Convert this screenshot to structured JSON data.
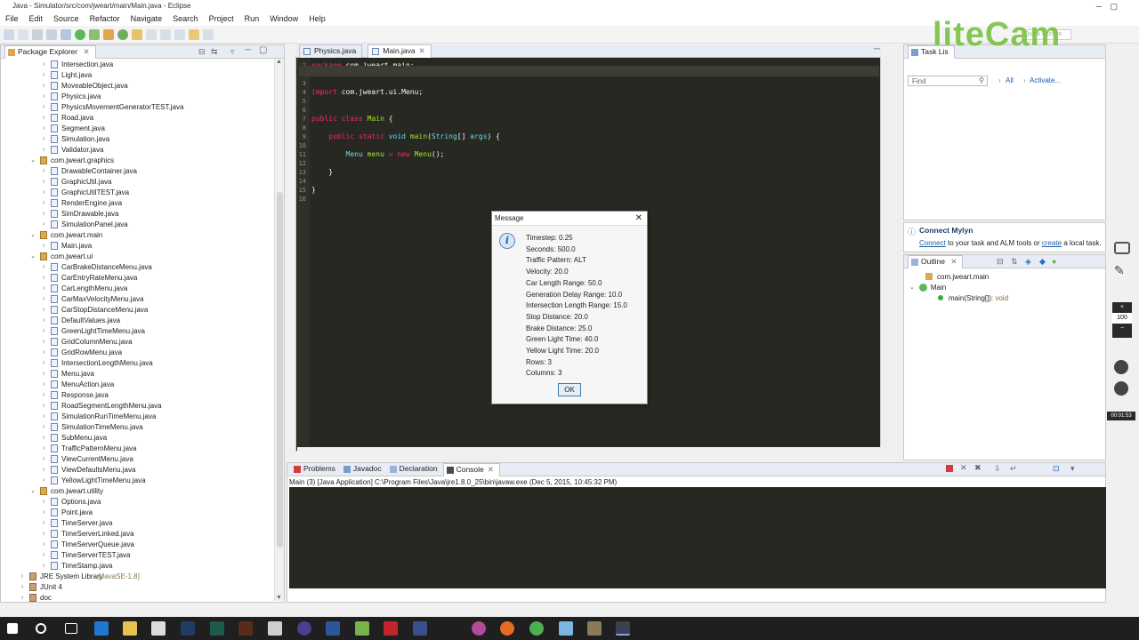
{
  "window": {
    "title": "Java - Simulator/src/com/jweart/main/Main.java - Eclipse"
  },
  "menu": [
    "File",
    "Edit",
    "Source",
    "Refactor",
    "Navigate",
    "Search",
    "Project",
    "Run",
    "Window",
    "Help"
  ],
  "quick_access": {
    "placeholder": "Quick Access"
  },
  "package_explorer": {
    "title": "Package Explorer",
    "items": [
      {
        "label": "Intersection.java",
        "indent": 2,
        "kind": "file"
      },
      {
        "label": "Light.java",
        "indent": 2,
        "kind": "file"
      },
      {
        "label": "MoveableObject.java",
        "indent": 2,
        "kind": "file"
      },
      {
        "label": "Physics.java",
        "indent": 2,
        "kind": "file"
      },
      {
        "label": "PhysicsMovementGeneratorTEST.java",
        "indent": 2,
        "kind": "file"
      },
      {
        "label": "Road.java",
        "indent": 2,
        "kind": "file"
      },
      {
        "label": "Segment.java",
        "indent": 2,
        "kind": "file"
      },
      {
        "label": "Simulation.java",
        "indent": 2,
        "kind": "file"
      },
      {
        "label": "Validator.java",
        "indent": 2,
        "kind": "file"
      },
      {
        "label": "com.jweart.graphics",
        "indent": 1,
        "kind": "package"
      },
      {
        "label": "DrawableContainer.java",
        "indent": 2,
        "kind": "file"
      },
      {
        "label": "GraphicUtil.java",
        "indent": 2,
        "kind": "file"
      },
      {
        "label": "GraphicUtilTEST.java",
        "indent": 2,
        "kind": "file"
      },
      {
        "label": "RenderEngine.java",
        "indent": 2,
        "kind": "file"
      },
      {
        "label": "SimDrawable.java",
        "indent": 2,
        "kind": "file"
      },
      {
        "label": "SimulationPanel.java",
        "indent": 2,
        "kind": "file"
      },
      {
        "label": "com.jweart.main",
        "indent": 1,
        "kind": "package"
      },
      {
        "label": "Main.java",
        "indent": 2,
        "kind": "file"
      },
      {
        "label": "com.jweart.ui",
        "indent": 1,
        "kind": "package"
      },
      {
        "label": "CarBrakeDistanceMenu.java",
        "indent": 2,
        "kind": "file"
      },
      {
        "label": "CarEntryRateMenu.java",
        "indent": 2,
        "kind": "file"
      },
      {
        "label": "CarLengthMenu.java",
        "indent": 2,
        "kind": "file"
      },
      {
        "label": "CarMaxVelocityMenu.java",
        "indent": 2,
        "kind": "file"
      },
      {
        "label": "CarStopDistanceMenu.java",
        "indent": 2,
        "kind": "file"
      },
      {
        "label": "DefaultValues.java",
        "indent": 2,
        "kind": "file"
      },
      {
        "label": "GreenLightTimeMenu.java",
        "indent": 2,
        "kind": "file"
      },
      {
        "label": "GridColumnMenu.java",
        "indent": 2,
        "kind": "file"
      },
      {
        "label": "GridRowMenu.java",
        "indent": 2,
        "kind": "file"
      },
      {
        "label": "IntersectionLengthMenu.java",
        "indent": 2,
        "kind": "file"
      },
      {
        "label": "Menu.java",
        "indent": 2,
        "kind": "file"
      },
      {
        "label": "MenuAction.java",
        "indent": 2,
        "kind": "file"
      },
      {
        "label": "Response.java",
        "indent": 2,
        "kind": "file"
      },
      {
        "label": "RoadSegmentLengthMenu.java",
        "indent": 2,
        "kind": "file"
      },
      {
        "label": "SimulationRunTimeMenu.java",
        "indent": 2,
        "kind": "file"
      },
      {
        "label": "SimulationTimeMenu.java",
        "indent": 2,
        "kind": "file"
      },
      {
        "label": "SubMenu.java",
        "indent": 2,
        "kind": "file"
      },
      {
        "label": "TrafficPatternMenu.java",
        "indent": 2,
        "kind": "file"
      },
      {
        "label": "ViewCurrentMenu.java",
        "indent": 2,
        "kind": "file"
      },
      {
        "label": "ViewDefaultsMenu.java",
        "indent": 2,
        "kind": "file"
      },
      {
        "label": "YellowLightTimeMenu.java",
        "indent": 2,
        "kind": "file"
      },
      {
        "label": "com.jweart.utility",
        "indent": 1,
        "kind": "package"
      },
      {
        "label": "Options.java",
        "indent": 2,
        "kind": "file"
      },
      {
        "label": "Point.java",
        "indent": 2,
        "kind": "file"
      },
      {
        "label": "TimeServer.java",
        "indent": 2,
        "kind": "file"
      },
      {
        "label": "TimeServerLinked.java",
        "indent": 2,
        "kind": "file"
      },
      {
        "label": "TimeServerQueue.java",
        "indent": 2,
        "kind": "file"
      },
      {
        "label": "TimeServerTEST.java",
        "indent": 2,
        "kind": "file"
      },
      {
        "label": "TimeStamp.java",
        "indent": 2,
        "kind": "file"
      },
      {
        "label": "JRE System Library",
        "indent": 0,
        "kind": "library",
        "suffix": "[JavaSE-1.8]"
      },
      {
        "label": "JUnit 4",
        "indent": 0,
        "kind": "library"
      },
      {
        "label": "doc",
        "indent": 0,
        "kind": "library"
      }
    ]
  },
  "editor": {
    "tabs": [
      {
        "label": "Physics.java",
        "active": false
      },
      {
        "label": "Main.java",
        "active": true
      }
    ],
    "lines": [
      {
        "n": "1",
        "code": [
          [
            "kw",
            "package "
          ],
          [
            "pl",
            "com.jweart.main;"
          ]
        ]
      },
      {
        "n": "2",
        "code": []
      },
      {
        "n": "3",
        "code": []
      },
      {
        "n": "4",
        "code": [
          [
            "kw",
            "import "
          ],
          [
            "pl",
            "com.jweart.ui.Menu;"
          ]
        ]
      },
      {
        "n": "5",
        "code": []
      },
      {
        "n": "6",
        "code": []
      },
      {
        "n": "7",
        "code": [
          [
            "kw",
            "public class "
          ],
          [
            "cls",
            "Main "
          ],
          [
            "pl",
            "{"
          ]
        ]
      },
      {
        "n": "8",
        "code": []
      },
      {
        "n": "9",
        "code": [
          [
            "pl",
            "    "
          ],
          [
            "kw",
            "public static "
          ],
          [
            "ty",
            "void "
          ],
          [
            "cls",
            "main"
          ],
          [
            "pl",
            "("
          ],
          [
            "ty",
            "String"
          ],
          [
            "pl",
            "[] "
          ],
          [
            "ty",
            "args"
          ],
          [
            "pl",
            ") {"
          ]
        ]
      },
      {
        "n": "10",
        "code": []
      },
      {
        "n": "11",
        "code": [
          [
            "pl",
            "        "
          ],
          [
            "ty",
            "Menu "
          ],
          [
            "cls",
            "menu "
          ],
          [
            "kw",
            "= new "
          ],
          [
            "cls",
            "Menu"
          ],
          [
            "pl",
            "();"
          ]
        ]
      },
      {
        "n": "12",
        "code": []
      },
      {
        "n": "13",
        "code": [
          [
            "pl",
            "    }"
          ]
        ]
      },
      {
        "n": "14",
        "code": []
      },
      {
        "n": "15",
        "code": [
          [
            "pl",
            "}"
          ]
        ]
      },
      {
        "n": "16",
        "code": []
      }
    ]
  },
  "task_list": {
    "title": "Task Lis",
    "find_placeholder": "Find",
    "all": "All",
    "activate": "Activate..."
  },
  "mylyn": {
    "title": "Connect Mylyn",
    "connect": "Connect",
    "text1": " to your task and ALM tools or ",
    "create": "create",
    "text2": " a local task."
  },
  "outline": {
    "title": "Outline",
    "items": [
      {
        "label": "com.jweart.main"
      },
      {
        "label": "Main"
      },
      {
        "label": "main(String[])",
        "suffix": " : void"
      }
    ]
  },
  "console": {
    "tabs": [
      "Problems",
      "Javadoc",
      "Declaration",
      "Console"
    ],
    "status": "Main (3) [Java Application] C:\\Program Files\\Java\\jre1.8.0_25\\bin\\javaw.exe (Dec 5, 2015, 10:45:32 PM)"
  },
  "dialog": {
    "title": "Message",
    "lines": [
      "Timestep: 0.25",
      "Seconds: 500.0",
      "Traffic Pattern: ALT",
      "Velocity: 20.0",
      "Car Length Range: 50.0",
      "Generation Delay Range: 10.0",
      "Intersection Length Range: 15.0",
      "Stop Distance: 20.0",
      "Brake Distance: 25.0",
      "Green Light Time: 40.0",
      "Yellow Light Time: 20.0",
      "Rows: 3",
      "Columns: 3"
    ],
    "ok": "OK"
  },
  "watermark": "liteCam",
  "recorder": {
    "zoom": "100",
    "time": "00:01:53"
  },
  "colors": {
    "editor_bg": "#272822",
    "keyword": "#f92672",
    "type": "#66d9ef",
    "name": "#a6e22e",
    "accent": "#3c7fb1"
  }
}
